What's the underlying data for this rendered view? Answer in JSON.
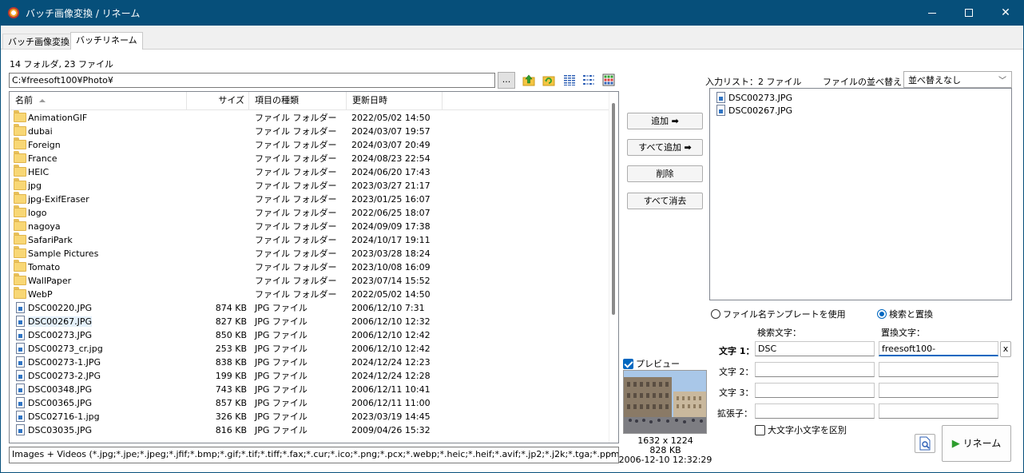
{
  "window": {
    "title": "バッチ画像変換 / リネーム"
  },
  "tabs": [
    {
      "label": "バッチ画像変換",
      "active": false
    },
    {
      "label": "バッチリネーム",
      "active": true
    }
  ],
  "summary": "14 フォルダ, 23 ファイル",
  "path": "C:¥freesoft100¥Photo¥",
  "browse_label": "...",
  "file_list": {
    "columns": {
      "name": "名前",
      "size": "サイズ",
      "type": "項目の種類",
      "date": "更新日時"
    },
    "rows": [
      {
        "kind": "folder",
        "name": "AnimationGIF",
        "size": "",
        "type": "ファイル フォルダー",
        "date": "2022/05/02 14:50"
      },
      {
        "kind": "folder",
        "name": "dubai",
        "size": "",
        "type": "ファイル フォルダー",
        "date": "2024/03/07 19:57"
      },
      {
        "kind": "folder",
        "name": "Foreign",
        "size": "",
        "type": "ファイル フォルダー",
        "date": "2024/03/07 20:49"
      },
      {
        "kind": "folder",
        "name": "France",
        "size": "",
        "type": "ファイル フォルダー",
        "date": "2024/08/23 22:54"
      },
      {
        "kind": "folder",
        "name": "HEIC",
        "size": "",
        "type": "ファイル フォルダー",
        "date": "2024/06/20 17:43"
      },
      {
        "kind": "folder",
        "name": "jpg",
        "size": "",
        "type": "ファイル フォルダー",
        "date": "2023/03/27 21:17"
      },
      {
        "kind": "folder",
        "name": "jpg-ExifEraser",
        "size": "",
        "type": "ファイル フォルダー",
        "date": "2023/01/25 16:07"
      },
      {
        "kind": "folder",
        "name": "logo",
        "size": "",
        "type": "ファイル フォルダー",
        "date": "2022/06/25 18:07"
      },
      {
        "kind": "folder",
        "name": "nagoya",
        "size": "",
        "type": "ファイル フォルダー",
        "date": "2024/09/09 17:38"
      },
      {
        "kind": "folder",
        "name": "SafariPark",
        "size": "",
        "type": "ファイル フォルダー",
        "date": "2024/10/17 19:11"
      },
      {
        "kind": "folder",
        "name": "Sample Pictures",
        "size": "",
        "type": "ファイル フォルダー",
        "date": "2023/03/28 18:24"
      },
      {
        "kind": "folder",
        "name": "Tomato",
        "size": "",
        "type": "ファイル フォルダー",
        "date": "2023/10/08 16:09"
      },
      {
        "kind": "folder",
        "name": "WallPaper",
        "size": "",
        "type": "ファイル フォルダー",
        "date": "2023/07/14 15:52"
      },
      {
        "kind": "folder",
        "name": "WebP",
        "size": "",
        "type": "ファイル フォルダー",
        "date": "2022/05/02 14:50"
      },
      {
        "kind": "jpg",
        "name": "DSC00220.JPG",
        "size": "874 KB",
        "type": "JPG ファイル",
        "date": "2006/12/10 7:31"
      },
      {
        "kind": "jpg",
        "name": "DSC00267.JPG",
        "size": "827 KB",
        "type": "JPG ファイル",
        "date": "2006/12/10 12:32",
        "selected": true
      },
      {
        "kind": "jpg",
        "name": "DSC00273.JPG",
        "size": "850 KB",
        "type": "JPG ファイル",
        "date": "2006/12/10 12:42"
      },
      {
        "kind": "jpg",
        "name": "DSC00273_cr.jpg",
        "size": "253 KB",
        "type": "JPG ファイル",
        "date": "2006/12/10 12:42"
      },
      {
        "kind": "jpg",
        "name": "DSC00273-1.JPG",
        "size": "838 KB",
        "type": "JPG ファイル",
        "date": "2024/12/24 12:23"
      },
      {
        "kind": "jpg",
        "name": "DSC00273-2.JPG",
        "size": "199 KB",
        "type": "JPG ファイル",
        "date": "2024/12/24 12:28"
      },
      {
        "kind": "jpg",
        "name": "DSC00348.JPG",
        "size": "743 KB",
        "type": "JPG ファイル",
        "date": "2006/12/11 10:41"
      },
      {
        "kind": "jpg",
        "name": "DSC00365.JPG",
        "size": "857 KB",
        "type": "JPG ファイル",
        "date": "2006/12/11 11:00"
      },
      {
        "kind": "jpg",
        "name": "DSC02716-1.jpg",
        "size": "326 KB",
        "type": "JPG ファイル",
        "date": "2023/03/19 14:45"
      },
      {
        "kind": "jpg",
        "name": "DSC03035.JPG",
        "size": "816 KB",
        "type": "JPG ファイル",
        "date": "2009/04/26 15:32"
      }
    ]
  },
  "filter": "Images + Videos (*.jpg;*.jpe;*.jpeg;*.jfif;*.bmp;*.gif;*.tif;*.tiff;*.fax;*.cur;*.ico;*.png;*.pcx;*.webp;*.heic;*.heif;*.avif;*.jp2;*.j2k;*.tga;*.ppm;*.w",
  "middle_buttons": {
    "add": "追加",
    "add_all": "すべて追加",
    "delete": "削除",
    "clear_all": "すべて消去"
  },
  "input_list": {
    "label": "入力リスト：2 ファイル",
    "sort_label": "ファイルの並べ替え：",
    "sort_value": "並べ替えなし",
    "items": [
      "DSC00273.JPG",
      "DSC00267.JPG"
    ]
  },
  "preview": {
    "label": "プレビュー",
    "checked": true,
    "dimensions": "1632 x 1224",
    "size": "828 KB",
    "datetime": "2006-12-10 12:32:29"
  },
  "rename_mode": {
    "template_label": "ファイル名テンプレートを使用",
    "search_replace_label": "検索と置換",
    "selected": "search_replace"
  },
  "search_replace": {
    "search_header": "検索文字：",
    "replace_header": "置換文字：",
    "rows": [
      {
        "label": "文字 1：",
        "search": "DSC",
        "replace": "freesoft100-",
        "bold": true
      },
      {
        "label": "文字 2：",
        "search": "",
        "replace": ""
      },
      {
        "label": "文字 3：",
        "search": "",
        "replace": ""
      },
      {
        "label": "拡張子：",
        "search": "",
        "replace": ""
      }
    ],
    "clear_label": "x",
    "case_sensitive_label": "大文字小文字を区別",
    "case_sensitive": false
  },
  "rename_button": "リネーム",
  "colors": {
    "titlebar": "#064f7a",
    "accent": "#0067c0",
    "rename_play": "#2e9d2e"
  }
}
